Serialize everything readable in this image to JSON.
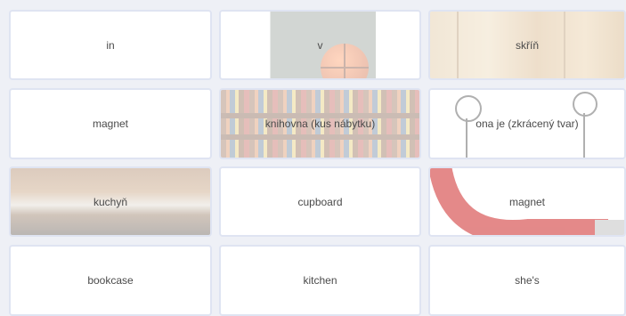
{
  "cards": [
    {
      "label": "in"
    },
    {
      "label": "v"
    },
    {
      "label": "skříň"
    },
    {
      "label": "magnet"
    },
    {
      "label": "knihovna (kus nábytku)"
    },
    {
      "label": "ona je (zkrácený tvar)"
    },
    {
      "label": "kuchyň"
    },
    {
      "label": "cupboard"
    },
    {
      "label": "magnet"
    },
    {
      "label": "bookcase"
    },
    {
      "label": "kitchen"
    },
    {
      "label": "she's"
    }
  ]
}
